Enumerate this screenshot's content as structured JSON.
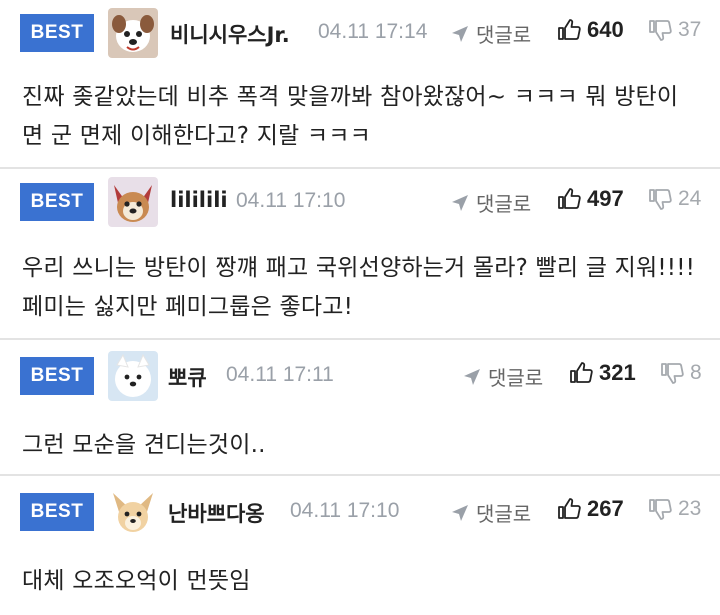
{
  "comments": [
    {
      "badge": "BEST",
      "nickname": "비니시우스Jr.",
      "date": "04.11 17:14",
      "reply_label": "댓글로",
      "likes": "640",
      "dislikes": "37",
      "body": "진짜 좆같았는데 비추 폭격 맞을까봐 참아왔잖어~ ㅋㅋㅋ 뭐 방탄이면 군 면제 이해한다고? 지랄 ㅋㅋㅋ"
    },
    {
      "badge": "BEST",
      "nickname": "lililili",
      "date": "04.11 17:10",
      "reply_label": "댓글로",
      "likes": "497",
      "dislikes": "24",
      "body": "우리 쓰니는 방탄이 짱꺠 패고 국위선양하는거 몰라? 빨리 글 지워!!!! 페미는 싫지만 페미그룹은 좋다고!"
    },
    {
      "badge": "BEST",
      "nickname": "뽀큐",
      "date": "04.11 17:11",
      "reply_label": "댓글로",
      "likes": "321",
      "dislikes": "8",
      "body": "그런 모순을 견디는것이.."
    },
    {
      "badge": "BEST",
      "nickname": "난바쁘다옹",
      "date": "04.11 17:10",
      "reply_label": "댓글로",
      "likes": "267",
      "dislikes": "23",
      "body": "대체 오조오억이 먼뜻임"
    }
  ],
  "colors": {
    "badge": "#3a72d1",
    "date": "#9aa0a8",
    "divider": "#e3e3e3",
    "dislike": "#a5a9ae"
  },
  "icons": {
    "reply": "send-arrow-icon",
    "like": "thumbs-up-icon",
    "dislike": "thumbs-down-icon"
  }
}
